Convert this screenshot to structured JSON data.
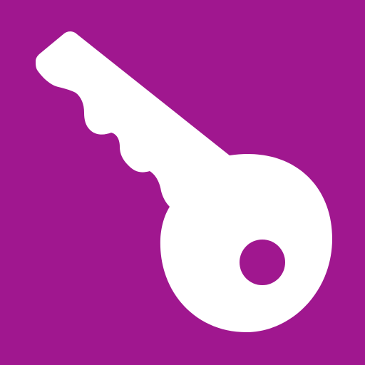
{
  "app_tile": {
    "icon": "key-icon",
    "colors": {
      "background": "#a0178f",
      "icon": "#ffffff"
    }
  }
}
